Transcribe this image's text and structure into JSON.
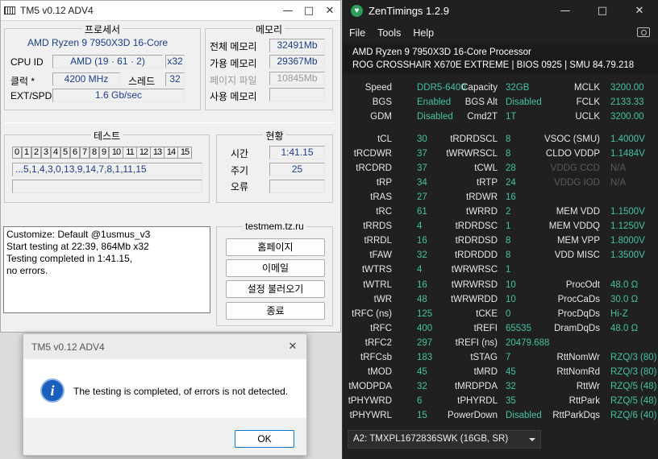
{
  "tm5": {
    "title": "TM5 v0.12 ADV4",
    "window_buttons": {
      "minimize": "—",
      "maximize": "□",
      "close": "✕"
    },
    "processor_header": "프로세서",
    "memory_header": "메모리",
    "cpu_name": "AMD Ryzen 9 7950X3D 16-Core",
    "cpu_id_label": "CPU ID",
    "cpu_id_value": "AMD  (19 · 61 · 2)",
    "cpu_arch": "x32",
    "clock_label": "클럭 *",
    "clock_value": "4200 MHz",
    "threads_label": "스레드",
    "threads_value": "32",
    "ext_spd_label": "EXT/SPD",
    "ext_spd_value": "1.6 Gb/sec",
    "total_mem_label": "전체 메모리",
    "total_mem_value": "32491Mb",
    "avail_mem_label": "가용 메모리",
    "avail_mem_value": "29367Mb",
    "page_file_label": "페이지 파일",
    "page_file_value": "10845Mb",
    "used_mem_label": "사용 메모리",
    "used_mem_value": "",
    "test_header": "테스트",
    "test_cells": [
      "0",
      "1",
      "2",
      "3",
      "4",
      "5",
      "6",
      "7",
      "8",
      "9",
      "10",
      "11",
      "12",
      "13",
      "14",
      "15"
    ],
    "test_sequence": "...5,1,4,3,0,13,9,14,7,8,1,11,15",
    "status_header": "현황",
    "time_label": "시간",
    "time_value": "1:41.15",
    "cycle_label": "주기",
    "cycle_value": "25",
    "error_label": "오류",
    "error_value": "",
    "log_lines": [
      "Customize: Default @1usmus_v3",
      "Start testing at 22:39, 864Mb x32",
      "Testing completed in 1:41.15,",
      "no errors."
    ],
    "site_header": "testmem.tz.ru",
    "buttons": {
      "homepage": "홈페이지",
      "email": "이메일",
      "load_settings": "설정 불러오기",
      "exit": "종료"
    }
  },
  "dialog": {
    "title": "TM5 v0.12 ADV4",
    "close": "✕",
    "icon": "info-icon",
    "message": "The testing is completed, of errors is not detected.",
    "ok": "OK"
  },
  "zen": {
    "title": "ZenTimings 1.2.9",
    "window_buttons": {
      "minimize": "—",
      "maximize": "□",
      "close": "✕"
    },
    "menu": [
      "File",
      "Tools",
      "Help"
    ],
    "cpu_line": "AMD Ryzen 9 7950X3D 16-Core Processor",
    "board_line": "ROG CROSSHAIR X670E EXTREME | BIOS 0925 | SMU 84.79.218",
    "colors": {
      "value": "#44c2a2",
      "background": "#202020",
      "dim": "#5a5a5a"
    },
    "group1": [
      [
        "Speed",
        "DDR5-6400",
        "Capacity",
        "32GB",
        "MCLK",
        "3200.00"
      ],
      [
        "BGS",
        "Enabled",
        "BGS Alt",
        "Disabled",
        "FCLK",
        "2133.33"
      ],
      [
        "GDM",
        "Disabled",
        "Cmd2T",
        "1T",
        "UCLK",
        "3200.00"
      ]
    ],
    "group2": [
      [
        "tCL",
        "30",
        "tRDRDSCL",
        "8",
        "VSOC (SMU)",
        "1.4000V"
      ],
      [
        "tRCDWR",
        "37",
        "tWRWRSCL",
        "8",
        "CLDO VDDP",
        "1.1484V"
      ],
      [
        "tRCDRD",
        "37",
        "tCWL",
        "28",
        "VDDG CCD",
        "N/A"
      ],
      [
        "tRP",
        "34",
        "tRTP",
        "24",
        "VDDG IOD",
        "N/A"
      ],
      [
        "tRAS",
        "27",
        "tRDWR",
        "16",
        "",
        ""
      ],
      [
        "tRC",
        "61",
        "tWRRD",
        "2",
        "MEM VDD",
        "1.1500V"
      ],
      [
        "tRRDS",
        "4",
        "tRDRDSC",
        "1",
        "MEM VDDQ",
        "1.1250V"
      ],
      [
        "tRRDL",
        "16",
        "tRDRDSD",
        "8",
        "MEM VPP",
        "1.8000V"
      ],
      [
        "tFAW",
        "32",
        "tRDRDDD",
        "8",
        "VDD MISC",
        "1.3500V"
      ],
      [
        "tWTRS",
        "4",
        "tWRWRSC",
        "1",
        "",
        ""
      ],
      [
        "tWTRL",
        "16",
        "tWRWRSD",
        "10",
        "ProcOdt",
        "48.0 Ω"
      ],
      [
        "tWR",
        "48",
        "tWRWRDD",
        "10",
        "ProcCaDs",
        "30.0 Ω"
      ],
      [
        "tRFC (ns)",
        "125",
        "tCKE",
        "0",
        "ProcDqDs",
        "Hi-Z"
      ],
      [
        "tRFC",
        "400",
        "tREFI",
        "65535",
        "DramDqDs",
        "48.0 Ω"
      ],
      [
        "tRFC2",
        "297",
        "tREFI (ns)",
        "20479.688",
        "",
        ""
      ],
      [
        "tRFCsb",
        "183",
        "tSTAG",
        "7",
        "RttNomWr",
        "RZQ/3 (80)"
      ],
      [
        "tMOD",
        "45",
        "tMRD",
        "45",
        "RttNomRd",
        "RZQ/3 (80)"
      ],
      [
        "tMODPDA",
        "32",
        "tMRDPDA",
        "32",
        "RttWr",
        "RZQ/5 (48)"
      ],
      [
        "tPHYWRD",
        "6",
        "tPHYRDL",
        "35",
        "RttPark",
        "RZQ/5 (48)"
      ],
      [
        "tPHYWRL",
        "15",
        "PowerDown",
        "Disabled",
        "RttParkDqs",
        "RZQ/6 (40)"
      ]
    ],
    "dimm_select": "A2: TMXPL1672836SWK (16GB, SR)"
  }
}
